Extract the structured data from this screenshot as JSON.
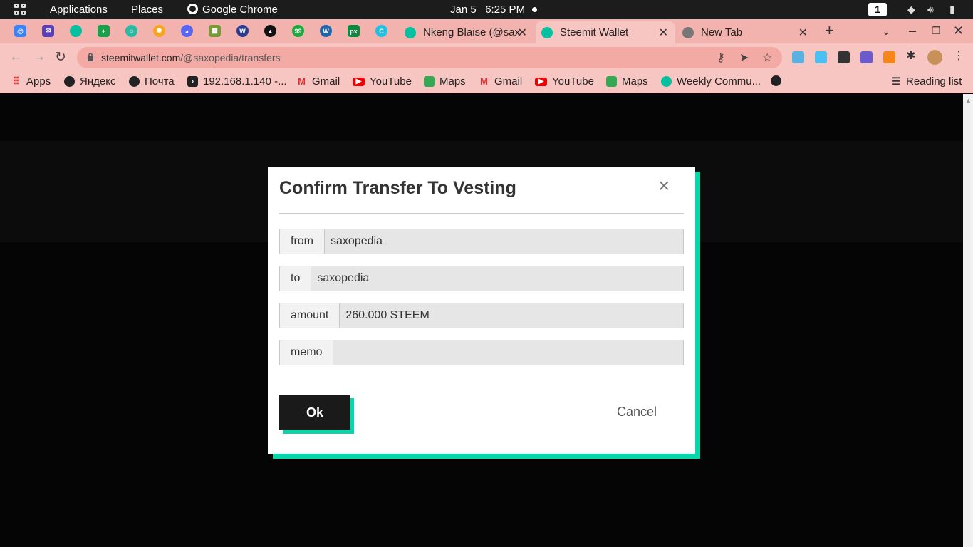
{
  "system_bar": {
    "applications": "Applications",
    "places": "Places",
    "active_app": "Google Chrome",
    "clock": "Jan 5   6:25 PM",
    "workspace": "1"
  },
  "tabs": [
    {
      "title": "Nkeng Blaise (@sax",
      "active": false
    },
    {
      "title": "Steemit Wallet",
      "active": true
    },
    {
      "title": "New Tab",
      "active": false
    }
  ],
  "address_bar": {
    "host": "steemitwallet.com",
    "path": "/@saxopedia/transfers"
  },
  "bookmarks": [
    {
      "label": "Apps",
      "icon": "apps-grid-icon"
    },
    {
      "label": "Яндекс",
      "icon": "globe-icon"
    },
    {
      "label": "Почта",
      "icon": "globe-icon"
    },
    {
      "label": "192.168.1.140 -...",
      "icon": "terminal-icon"
    },
    {
      "label": "Gmail",
      "icon": "gmail-icon"
    },
    {
      "label": "YouTube",
      "icon": "youtube-icon"
    },
    {
      "label": "Maps",
      "icon": "maps-icon"
    },
    {
      "label": "Gmail",
      "icon": "gmail-icon"
    },
    {
      "label": "YouTube",
      "icon": "youtube-icon"
    },
    {
      "label": "Maps",
      "icon": "maps-icon"
    },
    {
      "label": "Weekly Commu...",
      "icon": "steemit-icon"
    }
  ],
  "reading_list": "Reading list",
  "modal": {
    "title": "Confirm Transfer To Vesting",
    "fields": [
      {
        "label": "from",
        "value": "saxopedia"
      },
      {
        "label": "to",
        "value": "saxopedia"
      },
      {
        "label": "amount",
        "value": "260.000 STEEM"
      },
      {
        "label": "memo",
        "value": ""
      }
    ],
    "ok_label": "Ok",
    "cancel_label": "Cancel"
  },
  "colors": {
    "accent": "#06d6a9",
    "tab_strip": "#f2b2ae",
    "toolbar": "#f8c6c2"
  }
}
